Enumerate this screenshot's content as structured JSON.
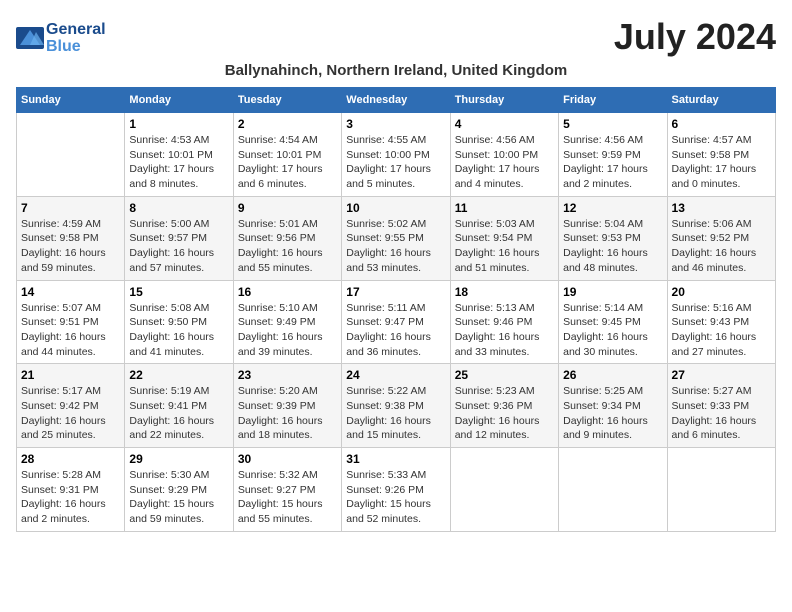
{
  "logo": {
    "line1": "General",
    "line2": "Blue"
  },
  "title": "July 2024",
  "subtitle": "Ballynahinch, Northern Ireland, United Kingdom",
  "headers": [
    "Sunday",
    "Monday",
    "Tuesday",
    "Wednesday",
    "Thursday",
    "Friday",
    "Saturday"
  ],
  "weeks": [
    [
      {
        "day": "",
        "sunrise": "",
        "sunset": "",
        "daylight": ""
      },
      {
        "day": "1",
        "sunrise": "Sunrise: 4:53 AM",
        "sunset": "Sunset: 10:01 PM",
        "daylight": "Daylight: 17 hours and 8 minutes."
      },
      {
        "day": "2",
        "sunrise": "Sunrise: 4:54 AM",
        "sunset": "Sunset: 10:01 PM",
        "daylight": "Daylight: 17 hours and 6 minutes."
      },
      {
        "day": "3",
        "sunrise": "Sunrise: 4:55 AM",
        "sunset": "Sunset: 10:00 PM",
        "daylight": "Daylight: 17 hours and 5 minutes."
      },
      {
        "day": "4",
        "sunrise": "Sunrise: 4:56 AM",
        "sunset": "Sunset: 10:00 PM",
        "daylight": "Daylight: 17 hours and 4 minutes."
      },
      {
        "day": "5",
        "sunrise": "Sunrise: 4:56 AM",
        "sunset": "Sunset: 9:59 PM",
        "daylight": "Daylight: 17 hours and 2 minutes."
      },
      {
        "day": "6",
        "sunrise": "Sunrise: 4:57 AM",
        "sunset": "Sunset: 9:58 PM",
        "daylight": "Daylight: 17 hours and 0 minutes."
      }
    ],
    [
      {
        "day": "7",
        "sunrise": "Sunrise: 4:59 AM",
        "sunset": "Sunset: 9:58 PM",
        "daylight": "Daylight: 16 hours and 59 minutes."
      },
      {
        "day": "8",
        "sunrise": "Sunrise: 5:00 AM",
        "sunset": "Sunset: 9:57 PM",
        "daylight": "Daylight: 16 hours and 57 minutes."
      },
      {
        "day": "9",
        "sunrise": "Sunrise: 5:01 AM",
        "sunset": "Sunset: 9:56 PM",
        "daylight": "Daylight: 16 hours and 55 minutes."
      },
      {
        "day": "10",
        "sunrise": "Sunrise: 5:02 AM",
        "sunset": "Sunset: 9:55 PM",
        "daylight": "Daylight: 16 hours and 53 minutes."
      },
      {
        "day": "11",
        "sunrise": "Sunrise: 5:03 AM",
        "sunset": "Sunset: 9:54 PM",
        "daylight": "Daylight: 16 hours and 51 minutes."
      },
      {
        "day": "12",
        "sunrise": "Sunrise: 5:04 AM",
        "sunset": "Sunset: 9:53 PM",
        "daylight": "Daylight: 16 hours and 48 minutes."
      },
      {
        "day": "13",
        "sunrise": "Sunrise: 5:06 AM",
        "sunset": "Sunset: 9:52 PM",
        "daylight": "Daylight: 16 hours and 46 minutes."
      }
    ],
    [
      {
        "day": "14",
        "sunrise": "Sunrise: 5:07 AM",
        "sunset": "Sunset: 9:51 PM",
        "daylight": "Daylight: 16 hours and 44 minutes."
      },
      {
        "day": "15",
        "sunrise": "Sunrise: 5:08 AM",
        "sunset": "Sunset: 9:50 PM",
        "daylight": "Daylight: 16 hours and 41 minutes."
      },
      {
        "day": "16",
        "sunrise": "Sunrise: 5:10 AM",
        "sunset": "Sunset: 9:49 PM",
        "daylight": "Daylight: 16 hours and 39 minutes."
      },
      {
        "day": "17",
        "sunrise": "Sunrise: 5:11 AM",
        "sunset": "Sunset: 9:47 PM",
        "daylight": "Daylight: 16 hours and 36 minutes."
      },
      {
        "day": "18",
        "sunrise": "Sunrise: 5:13 AM",
        "sunset": "Sunset: 9:46 PM",
        "daylight": "Daylight: 16 hours and 33 minutes."
      },
      {
        "day": "19",
        "sunrise": "Sunrise: 5:14 AM",
        "sunset": "Sunset: 9:45 PM",
        "daylight": "Daylight: 16 hours and 30 minutes."
      },
      {
        "day": "20",
        "sunrise": "Sunrise: 5:16 AM",
        "sunset": "Sunset: 9:43 PM",
        "daylight": "Daylight: 16 hours and 27 minutes."
      }
    ],
    [
      {
        "day": "21",
        "sunrise": "Sunrise: 5:17 AM",
        "sunset": "Sunset: 9:42 PM",
        "daylight": "Daylight: 16 hours and 25 minutes."
      },
      {
        "day": "22",
        "sunrise": "Sunrise: 5:19 AM",
        "sunset": "Sunset: 9:41 PM",
        "daylight": "Daylight: 16 hours and 22 minutes."
      },
      {
        "day": "23",
        "sunrise": "Sunrise: 5:20 AM",
        "sunset": "Sunset: 9:39 PM",
        "daylight": "Daylight: 16 hours and 18 minutes."
      },
      {
        "day": "24",
        "sunrise": "Sunrise: 5:22 AM",
        "sunset": "Sunset: 9:38 PM",
        "daylight": "Daylight: 16 hours and 15 minutes."
      },
      {
        "day": "25",
        "sunrise": "Sunrise: 5:23 AM",
        "sunset": "Sunset: 9:36 PM",
        "daylight": "Daylight: 16 hours and 12 minutes."
      },
      {
        "day": "26",
        "sunrise": "Sunrise: 5:25 AM",
        "sunset": "Sunset: 9:34 PM",
        "daylight": "Daylight: 16 hours and 9 minutes."
      },
      {
        "day": "27",
        "sunrise": "Sunrise: 5:27 AM",
        "sunset": "Sunset: 9:33 PM",
        "daylight": "Daylight: 16 hours and 6 minutes."
      }
    ],
    [
      {
        "day": "28",
        "sunrise": "Sunrise: 5:28 AM",
        "sunset": "Sunset: 9:31 PM",
        "daylight": "Daylight: 16 hours and 2 minutes."
      },
      {
        "day": "29",
        "sunrise": "Sunrise: 5:30 AM",
        "sunset": "Sunset: 9:29 PM",
        "daylight": "Daylight: 15 hours and 59 minutes."
      },
      {
        "day": "30",
        "sunrise": "Sunrise: 5:32 AM",
        "sunset": "Sunset: 9:27 PM",
        "daylight": "Daylight: 15 hours and 55 minutes."
      },
      {
        "day": "31",
        "sunrise": "Sunrise: 5:33 AM",
        "sunset": "Sunset: 9:26 PM",
        "daylight": "Daylight: 15 hours and 52 minutes."
      },
      {
        "day": "",
        "sunrise": "",
        "sunset": "",
        "daylight": ""
      },
      {
        "day": "",
        "sunrise": "",
        "sunset": "",
        "daylight": ""
      },
      {
        "day": "",
        "sunrise": "",
        "sunset": "",
        "daylight": ""
      }
    ]
  ]
}
